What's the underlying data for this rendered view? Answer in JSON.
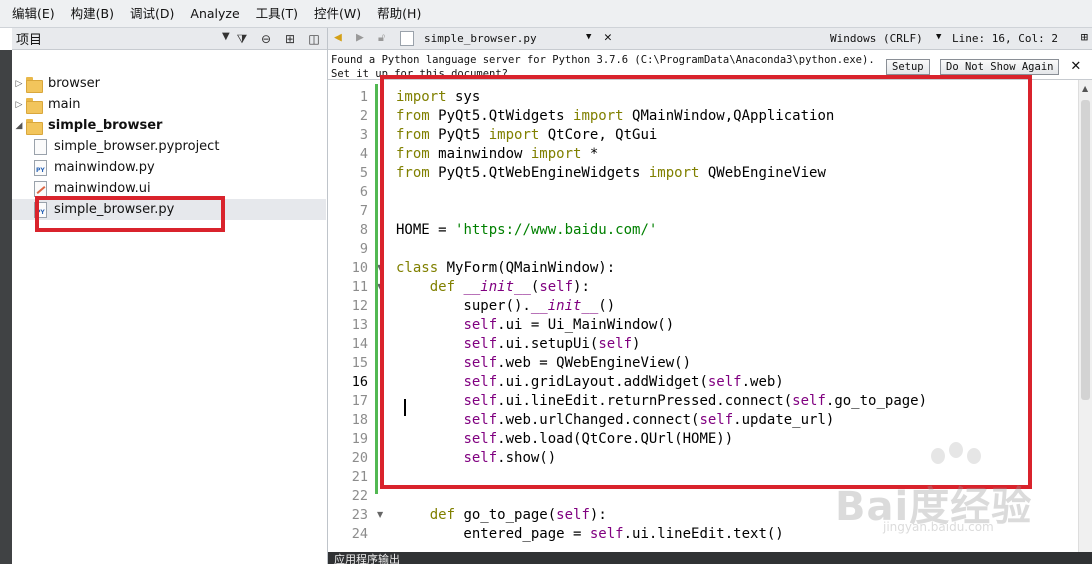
{
  "menubar": {
    "items": [
      "编辑(E)",
      "构建(B)",
      "调试(D)",
      "Analyze",
      "工具(T)",
      "控件(W)",
      "帮助(H)"
    ]
  },
  "projects": {
    "title": "项目",
    "tree": [
      {
        "label": "browser",
        "type": "folder",
        "expanded": false
      },
      {
        "label": "main",
        "type": "folder",
        "expanded": false
      },
      {
        "label": "simple_browser",
        "type": "folder",
        "expanded": true
      },
      {
        "label": "simple_browser.pyproject",
        "type": "file"
      },
      {
        "label": "mainwindow.py",
        "type": "py"
      },
      {
        "label": "mainwindow.ui",
        "type": "ui"
      },
      {
        "label": "simple_browser.py",
        "type": "py",
        "selected": true
      }
    ]
  },
  "editor": {
    "tab_name": "simple_browser.py",
    "encoding": "Windows (CRLF)",
    "cursor_position": "Line: 16, Col: 2",
    "info_message": "Found a Python language server for Python 3.7.6 (C:\\ProgramData\\Anaconda3\\python.exe). Set it up for this document?",
    "setup_label": "Setup",
    "dont_show_label": "Do Not Show Again",
    "current_line": 16,
    "code_lines": [
      "import sys",
      "from PyQt5.QtWidgets import QMainWindow,QApplication",
      "from PyQt5 import QtCore, QtGui",
      "from mainwindow import *",
      "from PyQt5.QtWebEngineWidgets import QWebEngineView",
      "",
      "",
      "HOME = 'https://www.baidu.com/'",
      "",
      "class MyForm(QMainWindow):",
      "    def __init__(self):",
      "        super().__init__()",
      "        self.ui = Ui_MainWindow()",
      "        self.ui.setupUi(self)",
      "        self.web = QWebEngineView()",
      "        self.ui.gridLayout.addWidget(self.web)",
      "        self.ui.lineEdit.returnPressed.connect(self.go_to_page)",
      "        self.web.urlChanged.connect(self.update_url)",
      "        self.web.load(QtCore.QUrl(HOME))",
      "        self.show()",
      "",
      "",
      "    def go_to_page(self):",
      "        entered_page = self.ui.lineEdit.text()"
    ]
  },
  "bottom_panel": {
    "label": "应用程序输出"
  },
  "watermark": {
    "text": "Bai度经验",
    "sub": "jingyan.baidu.com"
  },
  "colors": {
    "highlight_box": "#d9232c",
    "keyword": "#808000",
    "string": "#008000",
    "self": "#800080",
    "modified_bar": "#52b852"
  }
}
